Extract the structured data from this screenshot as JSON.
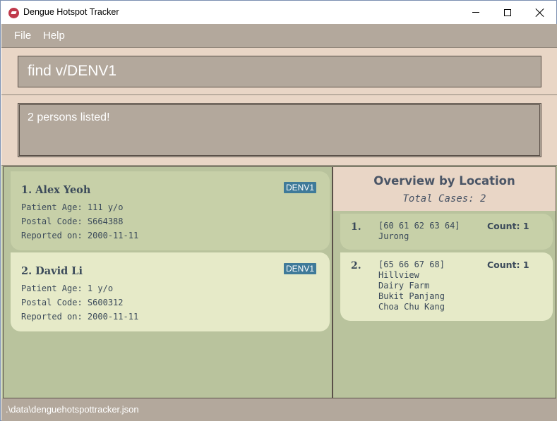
{
  "window": {
    "title": "Dengue Hotspot Tracker",
    "icon": "app-logo-icon"
  },
  "menu": {
    "items": [
      {
        "label": "File"
      },
      {
        "label": "Help"
      }
    ]
  },
  "command": {
    "value": "find v/DENV1"
  },
  "result": {
    "message": "2 persons listed!"
  },
  "persons": [
    {
      "name": "1. Alex Yeoh",
      "tag": "DENV1",
      "age": "Patient Age: 111 y/o",
      "postal": "Postal Code: S664388",
      "reported": "Reported on: 2000-11-11"
    },
    {
      "name": "2. David Li",
      "tag": "DENV1",
      "age": "Patient Age: 1 y/o",
      "postal": "Postal Code: S600312",
      "reported": "Reported on: 2000-11-11"
    }
  ],
  "overview": {
    "title": "Overview by Location",
    "total": "Total Cases: 2",
    "locations": [
      {
        "index": "1.",
        "codes": "[60 61 62 63 64]",
        "count": "Count: 1",
        "places": [
          "Jurong"
        ]
      },
      {
        "index": "2.",
        "codes": "[65 66 67 68]",
        "count": "Count: 1",
        "places": [
          "Hillview",
          "Dairy Farm",
          "Bukit Panjang",
          "Choa Chu Kang"
        ]
      }
    ]
  },
  "status": {
    "path": ".\\data\\denguehotspottracker.json"
  },
  "colors": {
    "menu_bg": "#b3a89c",
    "panel_bg": "#b9c39d",
    "header_bg": "#e9d6c6",
    "tag_bg": "#3f7a99"
  }
}
